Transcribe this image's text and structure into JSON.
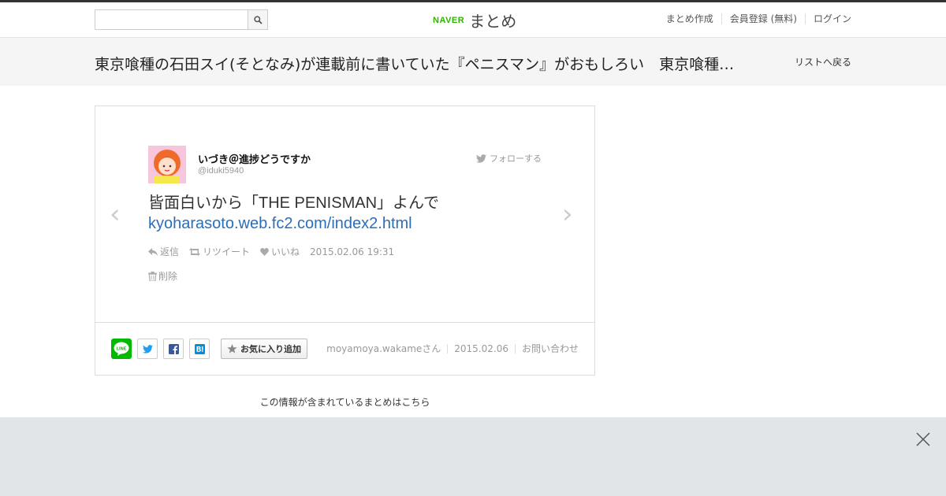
{
  "search": {
    "placeholder": ""
  },
  "logo": {
    "brand": "NAVER",
    "name": "まとめ"
  },
  "nav": {
    "create": "まとめ作成",
    "register": "会員登録 (無料)",
    "login": "ログイン"
  },
  "page": {
    "title": "東京喰種の石田スイ(そとなみ)が連載前に書いていた『ペニスマン』がおもしろい　東京喰種の石田スイ(そとなみ)",
    "back_label": "リストへ戻る"
  },
  "tweet": {
    "author": "いづき＠進捗どうですか",
    "handle": "@iduki5940",
    "follow_label": "フォローする",
    "text": "皆面白いから「THE PENISMAN」よんで",
    "link": "kyoharasoto.web.fc2.com/index2.html",
    "reply_label": "返信",
    "retweet_label": "リツイート",
    "like_label": "いいね",
    "timestamp": "2015.02.06 19:31",
    "delete_label": "削除"
  },
  "share": {
    "line_text": "LINE",
    "fav_label": "お気に入り追加"
  },
  "meta": {
    "user": "moyamoya.wakameさん",
    "date": "2015.02.06",
    "contact": "お問い合わせ"
  },
  "more_info": "この情報が含まれているまとめはこちら",
  "colors": {
    "naver_green": "#2db400",
    "link_blue": "#2a6ebb",
    "line_green": "#00b900",
    "ad_bg": "#e2e5e8"
  }
}
